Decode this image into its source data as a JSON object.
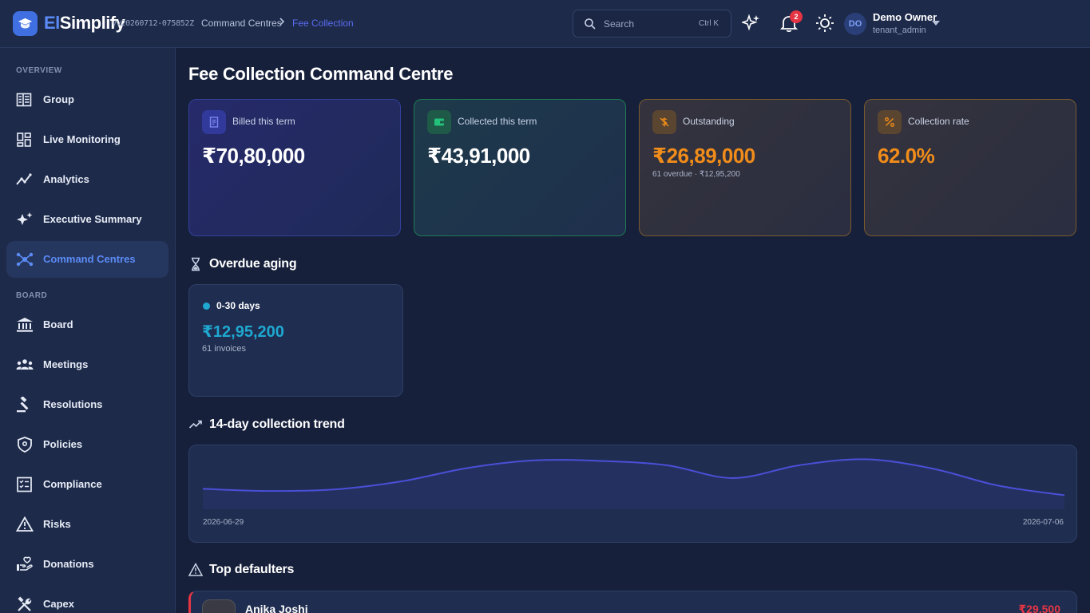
{
  "header": {
    "brand_prefix": "El",
    "brand_suffix": "Simplify",
    "version": "vv20260712-075852Z",
    "breadcrumb": [
      "Command Centres",
      "Fee Collection"
    ],
    "breadcrumb_separator": ">",
    "search": {
      "placeholder": "Search",
      "shortcut": "Ctrl K"
    },
    "notifications_count": "2",
    "user": {
      "initials": "DO",
      "name": "Demo Owner",
      "role": "tenant_admin"
    }
  },
  "sidebar": {
    "sections": [
      {
        "label": "OVERVIEW"
      },
      {
        "label": "BOARD"
      }
    ],
    "items": [
      {
        "label": "Group",
        "icon": "group-icon"
      },
      {
        "label": "Live Monitoring",
        "icon": "dashboard-icon"
      },
      {
        "label": "Analytics",
        "icon": "analytics-icon"
      },
      {
        "label": "Executive Summary",
        "icon": "sparkle-icon"
      },
      {
        "label": "Command Centres",
        "icon": "hub-icon",
        "active": true
      },
      {
        "label": "Board",
        "icon": "institution-icon"
      },
      {
        "label": "Meetings",
        "icon": "people-icon"
      },
      {
        "label": "Resolutions",
        "icon": "gavel-icon"
      },
      {
        "label": "Policies",
        "icon": "shield-icon"
      },
      {
        "label": "Compliance",
        "icon": "checklist-icon"
      },
      {
        "label": "Risks",
        "icon": "warning-icon"
      },
      {
        "label": "Donations",
        "icon": "donation-icon"
      },
      {
        "label": "Capex",
        "icon": "tools-icon"
      }
    ]
  },
  "main": {
    "title": "Fee Collection Command Centre",
    "kpis": {
      "billed": {
        "label": "Billed this term",
        "value": "₹70,80,000",
        "color": "#ffffff"
      },
      "collected": {
        "label": "Collected this term",
        "value": "₹43,91,000",
        "color": "#ffffff"
      },
      "outstanding": {
        "label": "Outstanding",
        "value": "₹26,89,000",
        "sub": "61 overdue · ₹12,95,200",
        "color": "#f08c1a"
      },
      "rate": {
        "label": "Collection rate",
        "value": "62.0%",
        "color": "#f08c1a"
      }
    },
    "aging": {
      "title": "Overdue aging",
      "buckets": [
        {
          "label": "0-30 days",
          "value": "₹12,95,200",
          "sub": "61 invoices",
          "color": "#1fa8d0"
        }
      ]
    },
    "trend": {
      "title": "14-day collection trend",
      "start_label": "2026-06-29",
      "end_label": "2026-07-06",
      "line_color": "#4a4fd8"
    },
    "defaulters": {
      "title": "Top defaulters",
      "items": [
        {
          "name": "Anika Joshi",
          "amount": "₹29,500"
        }
      ]
    }
  },
  "chart_data": {
    "type": "area",
    "title": "14-day collection trend",
    "x_start": "2026-06-29",
    "x_end": "2026-07-06",
    "values": [
      19,
      17,
      18.5,
      26,
      38.5,
      45.5,
      45,
      41,
      29,
      41,
      46.5,
      38,
      22,
      13
    ],
    "ylim": [
      0,
      55
    ],
    "grid": false,
    "legend": "none"
  }
}
